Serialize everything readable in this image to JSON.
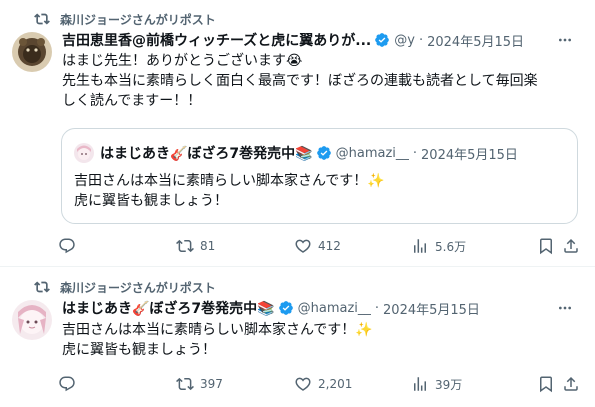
{
  "posts": [
    {
      "repost_label": "森川ジョージさんがリポスト",
      "author": "吉田恵里香@前橋ウィッチーズと虎に翼ありが...",
      "handle": "@y",
      "dot": "·",
      "date": "2024年5月15日",
      "lines": [
        "はまじ先生！ありがとうございます😭",
        "先生も本当に素晴らしく面白く最高です！ぼざろの連載も読者として毎回楽",
        "しく読んでますー！！"
      ],
      "quote": {
        "author": "はまじあき🎸ぼざろ7巻発売中📚",
        "handle": "@hamazi__",
        "dot": "·",
        "date": "2024年5月15日",
        "lines": [
          "吉田さんは本当に素晴らしい脚本家さんです！✨",
          "虎に翼皆も観ましょう！"
        ]
      },
      "actions": {
        "reply": "",
        "repost": "81",
        "like": "412",
        "views": "5.6万"
      }
    },
    {
      "repost_label": "森川ジョージさんがリポスト",
      "author": "はまじあき🎸ぼざろ7巻発売中📚",
      "handle": "@hamazi__",
      "dot": "·",
      "date": "2024年5月15日",
      "lines": [
        "吉田さんは本当に素晴らしい脚本家さんです！✨",
        "虎に翼皆も観ましょう！"
      ],
      "actions": {
        "reply": "",
        "repost": "397",
        "like": "2,201",
        "views": "39万"
      }
    }
  ],
  "colors": {
    "text": "#0f1419",
    "secondary": "#536471",
    "verified": "#1d9bf0",
    "border": "#cfd9de"
  },
  "icons": [
    "repost-icon",
    "verified-icon",
    "more-icon",
    "reply-icon",
    "like-icon",
    "views-icon",
    "bookmark-icon",
    "share-icon"
  ]
}
